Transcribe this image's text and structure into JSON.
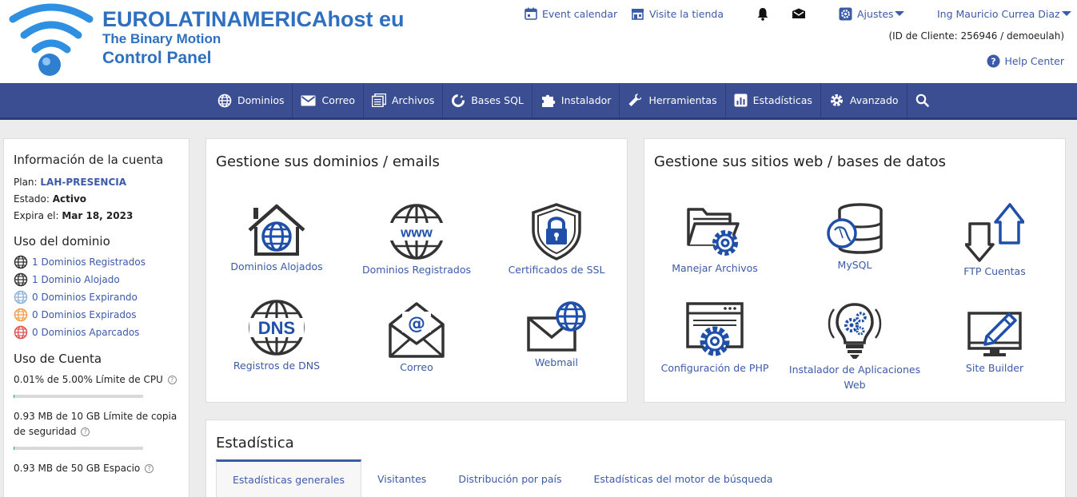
{
  "brand": {
    "line1": "EUROLATINAMERICAhost eu",
    "line2": "The Binary Motion",
    "line3": "Control Panel",
    "color": "#2f6fc0"
  },
  "header": {
    "event_calendar": "Event calendar",
    "visit_store": "Visite la tienda",
    "settings": "Ajustes",
    "user": "Ing Mauricio Currea Diaz",
    "client_id": "(ID de Cliente: 256946 / demoeulah)",
    "help": "Help Center"
  },
  "nav": {
    "items": [
      {
        "label": "Dominios",
        "icon": "globe-icon"
      },
      {
        "label": "Correo",
        "icon": "mail-icon"
      },
      {
        "label": "Archivos",
        "icon": "files-icon"
      },
      {
        "label": "Bases SQL",
        "icon": "database-icon"
      },
      {
        "label": "Instalador",
        "icon": "puzzle-icon"
      },
      {
        "label": "Herramientas",
        "icon": "wrench-icon"
      },
      {
        "label": "Estadísticas",
        "icon": "chart-icon"
      },
      {
        "label": "Avanzado",
        "icon": "gear-icon"
      }
    ],
    "search_icon": "search-icon",
    "color": "#3b4e91"
  },
  "sidebar": {
    "account_title": "Información de la cuenta",
    "plan_label": "Plan:",
    "plan_value": "LAH-PRESENCIA",
    "status_label": "Estado:",
    "status_value": "Activo",
    "expires_label": "Expira el:",
    "expires_value": "Mar 18, 2023",
    "domain_usage_title": "Uso del dominio",
    "domains": [
      {
        "label": "1 Dominios Registrados",
        "color": "#333333"
      },
      {
        "label": "1 Dominio Alojado",
        "color": "#333333"
      },
      {
        "label": "0 Dominios Expirando",
        "color": "#8fb3d9"
      },
      {
        "label": "0 Dominios Expirados",
        "color": "#f0a050"
      },
      {
        "label": "0 Dominios Aparcados",
        "color": "#e05050"
      }
    ],
    "account_usage_title": "Uso de Cuenta",
    "usage": [
      {
        "label": "0.01% de 5.00% Límite de CPU",
        "fraction": 0.002
      },
      {
        "label": "0.93 MB de 10 GB Límite de copia de seguridad",
        "fraction": 0.0
      },
      {
        "label": "0.93 MB de 50 GB Espacio",
        "fraction": 0.0
      }
    ]
  },
  "domains_panel": {
    "title": "Gestione sus dominios / emails",
    "tiles": [
      "Dominios Alojados",
      "Dominios Registrados",
      "Certificados de SSL",
      "Registros de DNS",
      "Correo",
      "Webmail"
    ],
    "www_text": "www",
    "dns_text": "DNS"
  },
  "sites_panel": {
    "title": "Gestione sus sitios web / bases de datos",
    "tiles": [
      "Manejar Archivos",
      "MySQL",
      "FTP Cuentas",
      "Configuración de PHP",
      "Instalador de Aplicaciones Web",
      "Site Builder"
    ]
  },
  "stats_panel": {
    "title": "Estadística",
    "tabs": [
      "Estadísticas generales",
      "Visitantes",
      "Distribución por país",
      "Estadísticas del motor de búsqueda"
    ],
    "active_tab": 0
  }
}
